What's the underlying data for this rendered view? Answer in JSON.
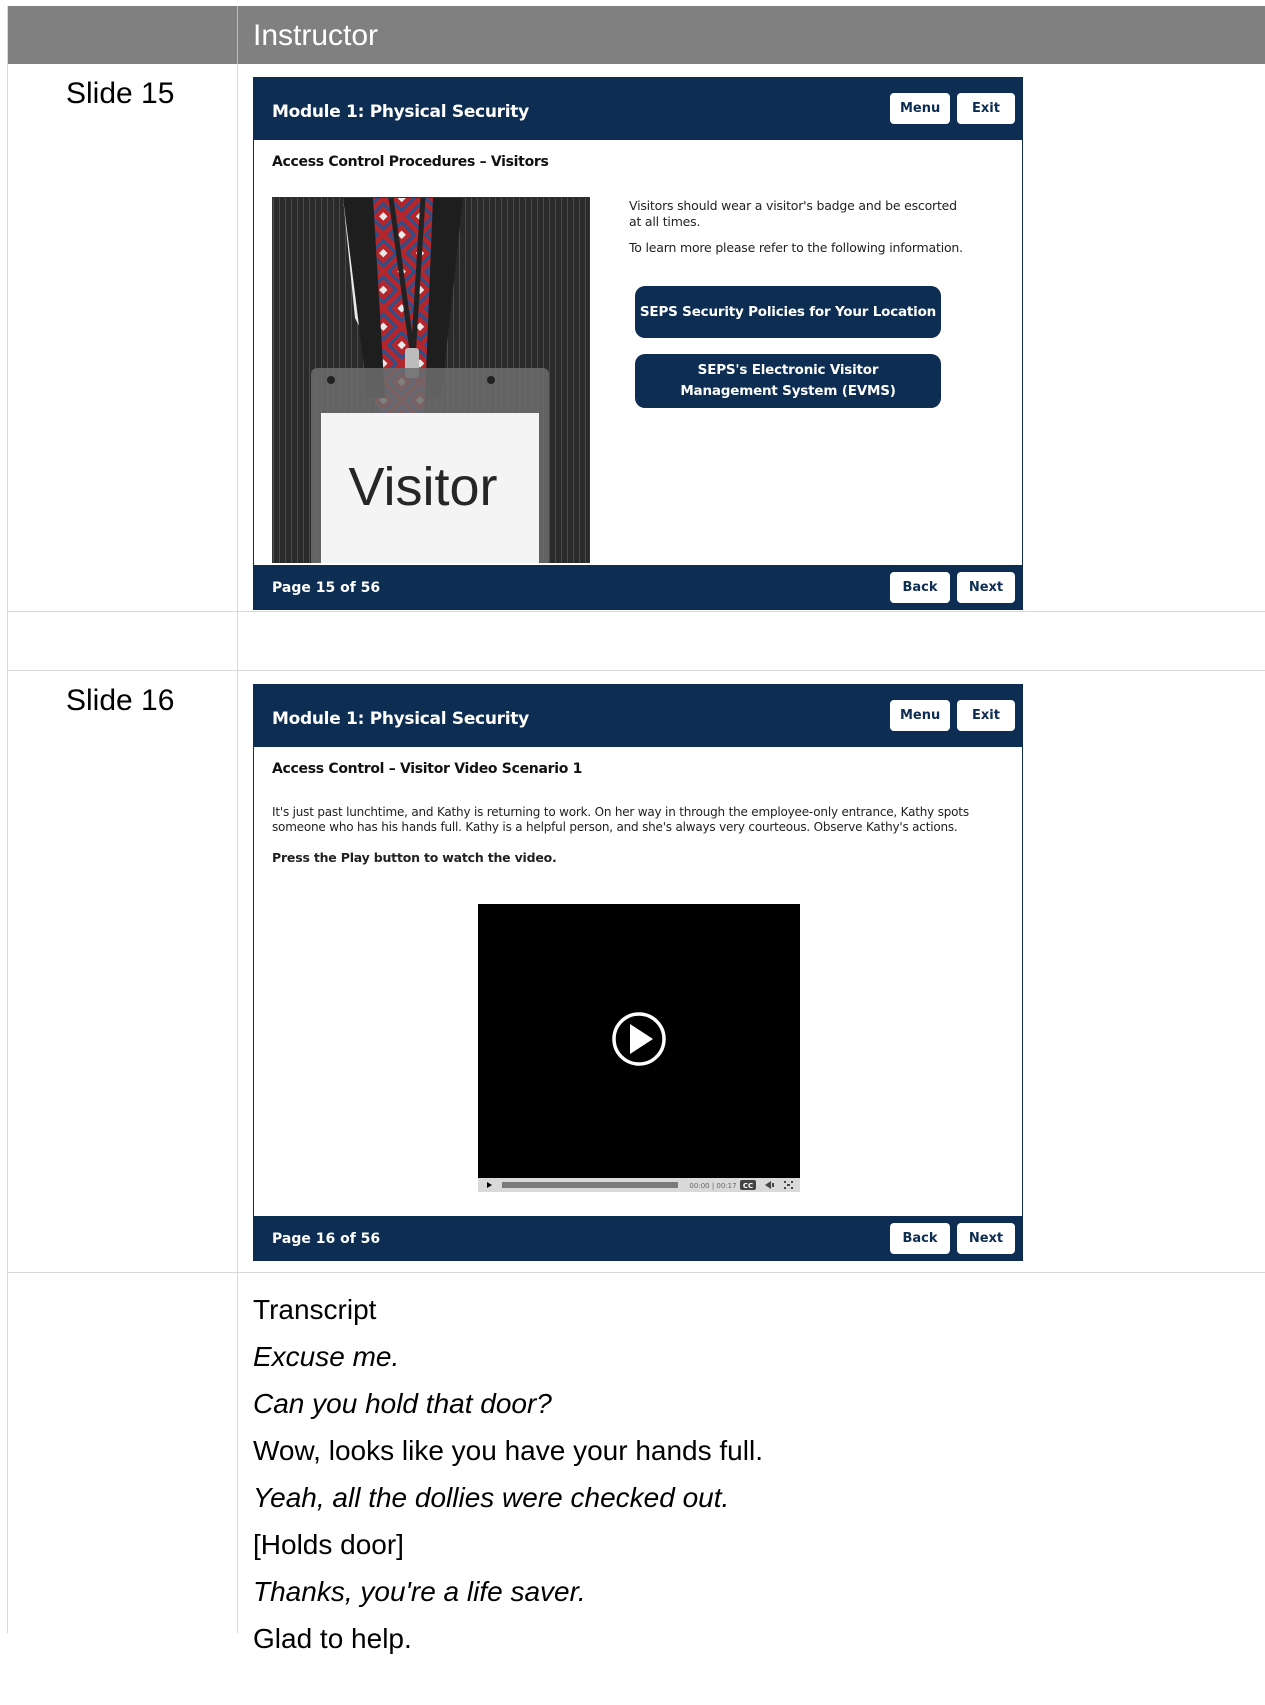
{
  "table": {
    "header": "Instructor"
  },
  "slides": [
    {
      "label": "Slide 15",
      "module_title": "Module 1: Physical Security",
      "menu_label": "Menu",
      "exit_label": "Exit",
      "heading": "Access Control Procedures – Visitors",
      "text_1": "Visitors should wear a visitor's badge and be escorted at all times.",
      "text_2": "To learn more please refer to the following information.",
      "image_badge_text": "Visitor",
      "link_1": "SEPS Security Policies for Your Location",
      "link_2": "SEPS's Electronic Visitor Management System (EVMS)",
      "page_indicator": "Page 15 of 56",
      "back_label": "Back",
      "next_label": "Next"
    },
    {
      "label": "Slide 16",
      "module_title": "Module 1: Physical Security",
      "menu_label": "Menu",
      "exit_label": "Exit",
      "heading": "Access Control – Visitor Video Scenario 1",
      "text_1": "It's just past lunchtime, and Kathy is returning to work. On her way in through the employee-only entrance, Kathy spots someone who has his hands full. Kathy is a helpful person, and she's always very courteous. Observe Kathy's actions.",
      "text_2": "Press the Play button to watch the video.",
      "video_time": "00:00 | 00:17",
      "page_indicator": "Page 16 of 56",
      "back_label": "Back",
      "next_label": "Next"
    }
  ],
  "transcript": {
    "title": "Transcript",
    "lines": [
      {
        "text": "Excuse me.",
        "italic": true
      },
      {
        "text": "Can you hold that door?",
        "italic": true
      },
      {
        "text": "Wow, looks like you have your hands full.",
        "italic": false
      },
      {
        "text": "Yeah, all the dollies were checked out.",
        "italic": true
      },
      {
        "text": "[Holds door]",
        "italic": false
      },
      {
        "text": "Thanks, you're a life saver.",
        "italic": true
      },
      {
        "text": "Glad to help.",
        "italic": false
      }
    ]
  }
}
